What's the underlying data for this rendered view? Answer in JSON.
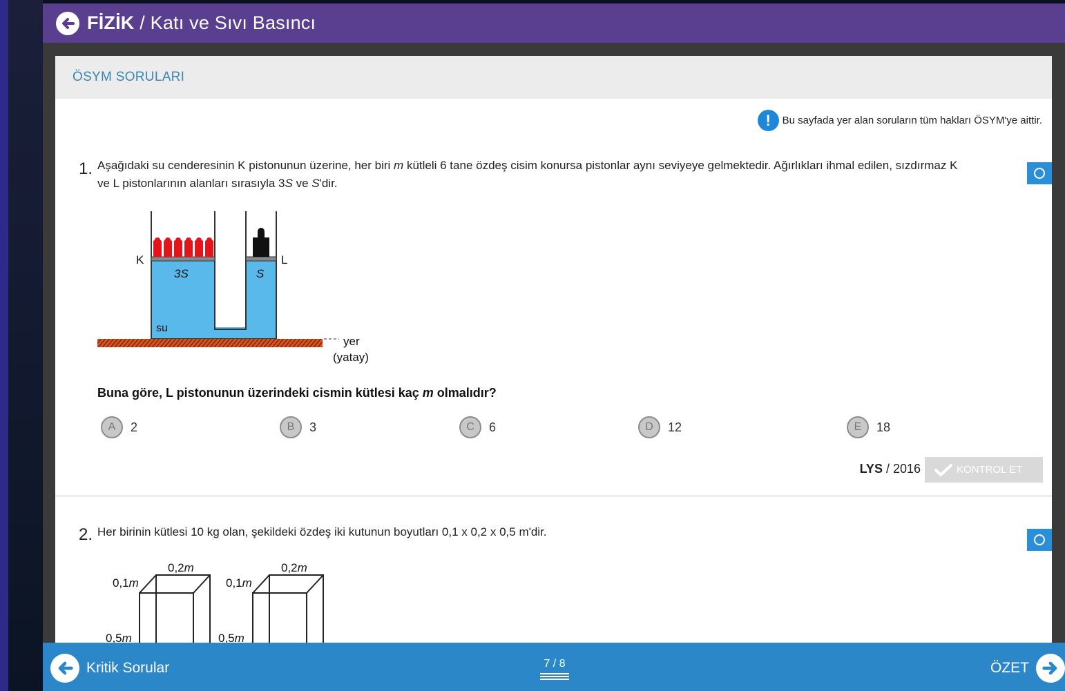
{
  "header": {
    "subject": "FİZİK",
    "separator": " / ",
    "topic": "Katı ve Sıvı Basıncı"
  },
  "section": {
    "title": "ÖSYM SORULARI"
  },
  "notice": {
    "text": "Bu sayfada yer alan soruların tüm hakları ÖSYM'ye aittir."
  },
  "question1": {
    "number": "1.",
    "text_line1_a": "Aşağıdaki su cenderesinin K pistonunun üzerine, her biri ",
    "text_line1_m": "m",
    "text_line1_b": " kütleli 6 tane özdeş cisim konursa pistonlar aynı seviyeye gelmektedir. Ağırlıkları ihmal edilen, sızdırmaz K",
    "text_line2_a": "ve L pistonlarının alanları sırasıyla 3",
    "text_line2_s1": "S",
    "text_line2_b": " ve ",
    "text_line2_s2": "S",
    "text_line2_c": "'dir.",
    "figure": {
      "label_k": "K",
      "label_l": "L",
      "label_3s": "3S",
      "label_s": "S",
      "label_su": "su",
      "label_yer": "yer",
      "label_yatay": "(yatay)"
    },
    "ask_a": "Buna göre, L pistonunun üzerindeki cismin kütlesi kaç ",
    "ask_m": "m",
    "ask_b": " olmalıdır?",
    "options": [
      {
        "letter": "A",
        "value": "2"
      },
      {
        "letter": "B",
        "value": "3"
      },
      {
        "letter": "C",
        "value": "6"
      },
      {
        "letter": "D",
        "value": "12"
      },
      {
        "letter": "E",
        "value": "18"
      }
    ],
    "source_exam": "LYS",
    "source_year": " / 2016",
    "check_label": "KONTROL ET"
  },
  "question2": {
    "number": "2.",
    "text": "Her birinin kütlesi 10 kg olan, şekildeki özdeş iki kutunun boyutları 0,1 x 0,2 x 0,5 m'dir.",
    "figure": {
      "box1_width": "0,2",
      "box1_depth": "0,1",
      "box1_height": "0,5",
      "box2_width": "0,2",
      "box2_depth": "0,1",
      "box2_height": "0,5",
      "unit": "m"
    }
  },
  "footer": {
    "left_label": "Kritik Sorular",
    "pager": "7 / 8",
    "right_label": "ÖZET"
  },
  "colors": {
    "header": "#5a3e8f",
    "footer": "#2b87c8",
    "water": "#58b9ea",
    "weights": "#e3141b",
    "ground": "#d9531e"
  }
}
